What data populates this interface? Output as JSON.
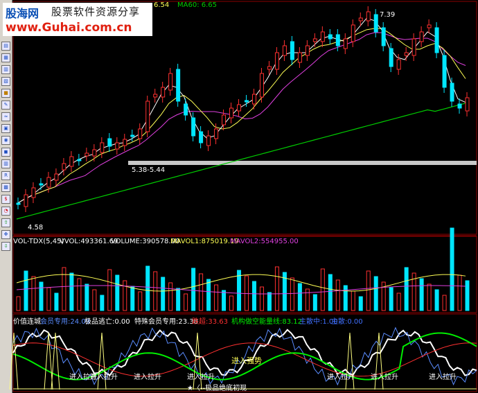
{
  "logo": {
    "brand_line1": "股海网",
    "brand_line1_tag": "股票软件资源分享",
    "brand_line2": "www.Guhai.com.cn"
  },
  "price_panel": {
    "ma_fragment": "6.54",
    "ma60_label": "MA60: 6.65",
    "high_marker": "7.39",
    "low_marker": "4.58",
    "range_label": "5.38-5.44"
  },
  "volume_panel": {
    "label_name": "VOL-TDX(5,45)",
    "vvol": "VVOL:493361.69",
    "volume": "VOLUME:390578.00",
    "mavol1": "MAVOL1:875019.19",
    "mavol2": "MAVOL2:554955.00"
  },
  "indicator_panel": {
    "title": "价值连城",
    "member_label": "会员专用:24.09",
    "jp_label": "极品逃亡:0.00",
    "special_label": "特殊会员专用:23.38",
    "fall_label": "跌超:33.63",
    "inst_label": "机构做空能量线:83.12",
    "main1": "主散中:1.00",
    "main2": "主散:0.00",
    "tag_jinru": "进入强势",
    "tag_labels": [
      "进入拉升",
      "进入拉升",
      "进入拉升",
      "进入拉升",
      "进入拉升",
      "进入拉升",
      "进入拉升"
    ],
    "bottom_note": "★〈--极品绝底初现"
  },
  "toolbar": {
    "icons": [
      "chart-icon",
      "line-icon",
      "grid-icon",
      "table-icon",
      "book-icon",
      "note-icon",
      "wave-icon",
      "tool-icon",
      "globe-icon",
      "rec-icon",
      "bar-icon",
      "rsi-icon",
      "graph-icon",
      "money-icon",
      "alarm-icon",
      "up-icon",
      "move-icon",
      "down-icon"
    ]
  },
  "colors": {
    "bg": "#000000",
    "up": "#ff3030",
    "down": "#00e6ff",
    "ma_white": "#ffffff",
    "ma_yellow": "#ffff55",
    "ma_purple": "#e040e0",
    "ma_green": "#00cc00",
    "grid": "#8b0000"
  },
  "chart_data": {
    "type": "candlestick",
    "price_range": [
      4.2,
      7.5
    ],
    "ma60_value": 6.65,
    "high": 7.39,
    "low": 4.58,
    "close_path": [
      4.62,
      4.75,
      4.85,
      4.9,
      5.0,
      5.05,
      5.2,
      5.3,
      5.25,
      5.35,
      5.4,
      5.5,
      5.45,
      5.5,
      5.55,
      5.6,
      5.7,
      6.1,
      6.2,
      6.3,
      6.5,
      6.1,
      5.9,
      5.6,
      5.5,
      5.6,
      5.7,
      5.9,
      6.0,
      6.05,
      6.1,
      6.2,
      6.5,
      6.6,
      6.8,
      6.9,
      6.7,
      6.8,
      6.9,
      7.0,
      7.1,
      7.0,
      6.9,
      7.0,
      7.2,
      7.3,
      7.39,
      7.1,
      6.9,
      6.6,
      6.7,
      6.8,
      7.0,
      7.1,
      7.2,
      6.8,
      6.3,
      6.1,
      6.0,
      6.15
    ]
  }
}
